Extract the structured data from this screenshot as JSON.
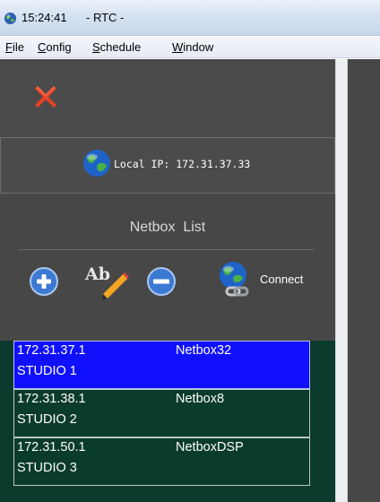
{
  "window": {
    "time": "15:24:41",
    "title": "- RTC -",
    "icon": "app-globe-icon"
  },
  "menu": {
    "file": {
      "mnemonic": "F",
      "rest": "ile"
    },
    "config": {
      "mnemonic": "C",
      "rest": "onfig"
    },
    "schedule": {
      "mnemonic": "S",
      "rest": "chedule"
    },
    "window": {
      "mnemonic": "W",
      "rest": "indow"
    }
  },
  "toolbar": {
    "close_icon": "red-x-icon",
    "connect_label": "Connect",
    "icons": [
      "add-icon",
      "rename-icon",
      "remove-icon",
      "connect-globe-icon"
    ]
  },
  "status": {
    "local_ip": "Local IP: 172.31.37.33"
  },
  "netbox_list": {
    "title": "Netbox  List",
    "rows": [
      {
        "ip": "172.31.37.1",
        "studio": "STUDIO 1",
        "name": "Netbox32",
        "selected": true
      },
      {
        "ip": "172.31.38.1",
        "studio": "STUDIO 2",
        "name": "Netbox8",
        "selected": false
      },
      {
        "ip": "172.31.50.1",
        "studio": "STUDIO 3",
        "name": "NetboxDSP",
        "selected": false
      }
    ]
  },
  "colors": {
    "panel": "#474747",
    "list_background": "#0b3b2c",
    "selected_row": "#1010ff",
    "close_red": "#e64025"
  }
}
